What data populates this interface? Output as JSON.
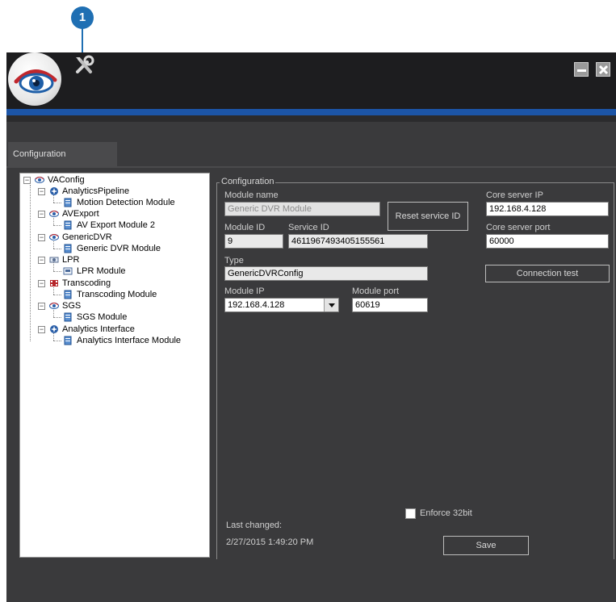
{
  "callout": {
    "number": "1"
  },
  "tab": {
    "label": "Configuration"
  },
  "tree": {
    "root": "VAConfig",
    "items": [
      {
        "label": "AnalyticsPipeline",
        "child": "Motion Detection Module"
      },
      {
        "label": "AVExport",
        "child": "AV Export Module 2"
      },
      {
        "label": "GenericDVR",
        "child": "Generic DVR Module"
      },
      {
        "label": "LPR",
        "child": "LPR Module"
      },
      {
        "label": "Transcoding",
        "child": "Transcoding Module"
      },
      {
        "label": "SGS",
        "child": "SGS Module"
      },
      {
        "label": "Analytics Interface",
        "child": "Analytics Interface Module"
      }
    ]
  },
  "config": {
    "legend": "Configuration",
    "module_name_label": "Module name",
    "module_name_value": "Generic DVR Module",
    "reset_button": "Reset service ID",
    "core_ip_label": "Core server IP",
    "core_ip_value": "192.168.4.128",
    "module_id_label": "Module ID",
    "module_id_value": "9",
    "service_id_label": "Service ID",
    "service_id_value": "4611967493405155561",
    "core_port_label": "Core server port",
    "core_port_value": "60000",
    "type_label": "Type",
    "type_value": "GenericDVRConfig",
    "conn_test_button": "Connection test",
    "module_ip_label": "Module IP",
    "module_ip_value": "192.168.4.128",
    "module_port_label": "Module port",
    "module_port_value": "60619",
    "enforce_label": "Enforce 32bit",
    "last_changed_label": "Last changed:",
    "last_changed_value": "2/27/2015 1:49:20 PM",
    "save_button": "Save"
  },
  "colors": {
    "accent_blue": "#1c55a7",
    "panel": "#3a3a3c",
    "titlebar": "#1d1d1f",
    "callout": "#1f6fb3"
  }
}
